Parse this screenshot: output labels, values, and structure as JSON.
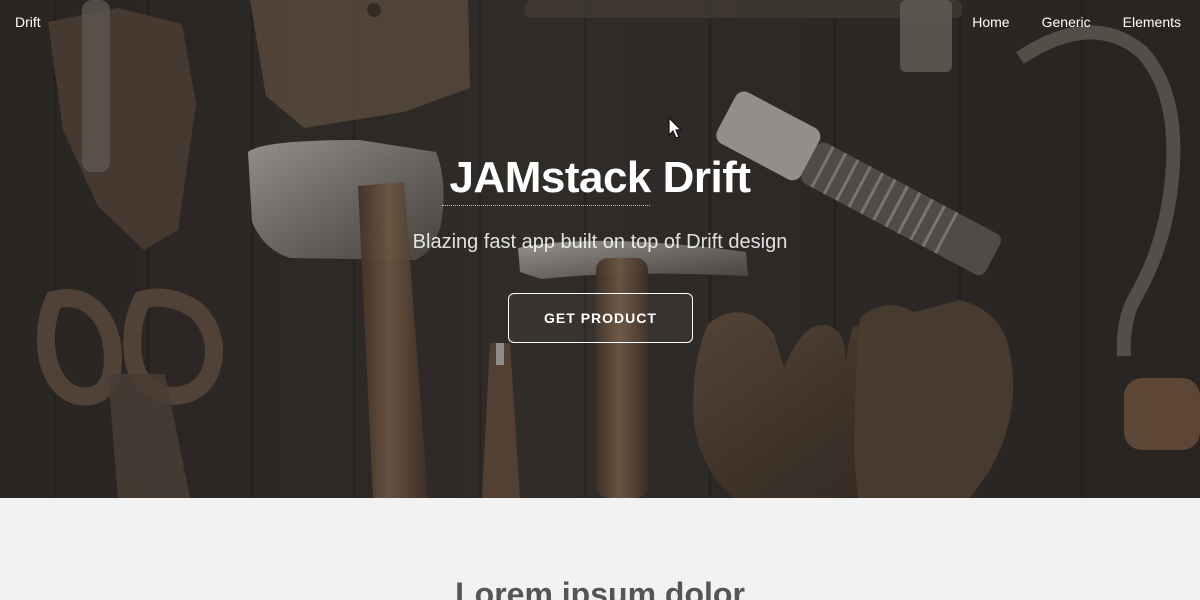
{
  "navigation": {
    "brand": "Drift",
    "links": [
      "Home",
      "Generic",
      "Elements"
    ]
  },
  "hero": {
    "title": "JAMstack Drift",
    "subtitle": "Blazing fast app built on top of Drift design",
    "button_label": "Get Product"
  },
  "section": {
    "heading": "Lorem ipsum dolor"
  },
  "icons": {
    "cursor": "mouse-pointer-icon"
  },
  "colors": {
    "hero_text": "#ffffff",
    "section_background": "#f2f2f2",
    "section_heading": "#555555"
  }
}
